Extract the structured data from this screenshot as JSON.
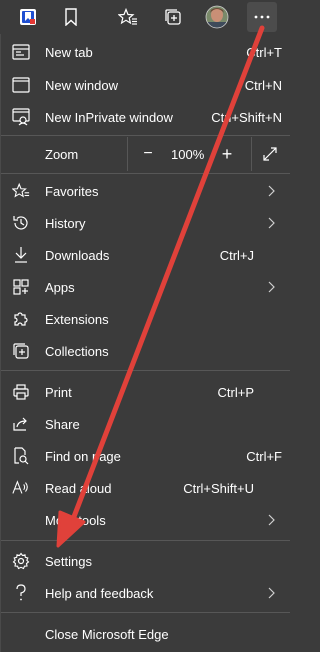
{
  "toolbar": {
    "icons": [
      "app-logo-icon",
      "bookmark-icon",
      "favorites-star-icon",
      "collections-icon",
      "profile-avatar",
      "more-options-icon"
    ]
  },
  "menu": {
    "new_tab": {
      "label": "New tab",
      "shortcut": "Ctrl+T"
    },
    "new_window": {
      "label": "New window",
      "shortcut": "Ctrl+N"
    },
    "new_inprivate": {
      "label": "New InPrivate window",
      "shortcut": "Ctrl+Shift+N"
    },
    "zoom": {
      "label": "Zoom",
      "value": "100%",
      "minus": "−",
      "plus": "+"
    },
    "favorites": {
      "label": "Favorites"
    },
    "history": {
      "label": "History"
    },
    "downloads": {
      "label": "Downloads",
      "shortcut": "Ctrl+J"
    },
    "apps": {
      "label": "Apps"
    },
    "extensions": {
      "label": "Extensions"
    },
    "collections": {
      "label": "Collections"
    },
    "print": {
      "label": "Print",
      "shortcut": "Ctrl+P"
    },
    "share": {
      "label": "Share"
    },
    "find_on_page": {
      "label": "Find on page",
      "shortcut": "Ctrl+F"
    },
    "read_aloud": {
      "label": "Read aloud",
      "shortcut": "Ctrl+Shift+U"
    },
    "more_tools": {
      "label": "More tools"
    },
    "settings": {
      "label": "Settings"
    },
    "help": {
      "label": "Help and feedback"
    },
    "close": {
      "label": "Close Microsoft Edge"
    }
  },
  "annotation": {
    "type": "red-arrow",
    "color": "#e0413a"
  },
  "colors": {
    "background": "#3b3b3b",
    "separator": "#575757",
    "text": "#ffffff",
    "arrow": "#e0413a"
  }
}
